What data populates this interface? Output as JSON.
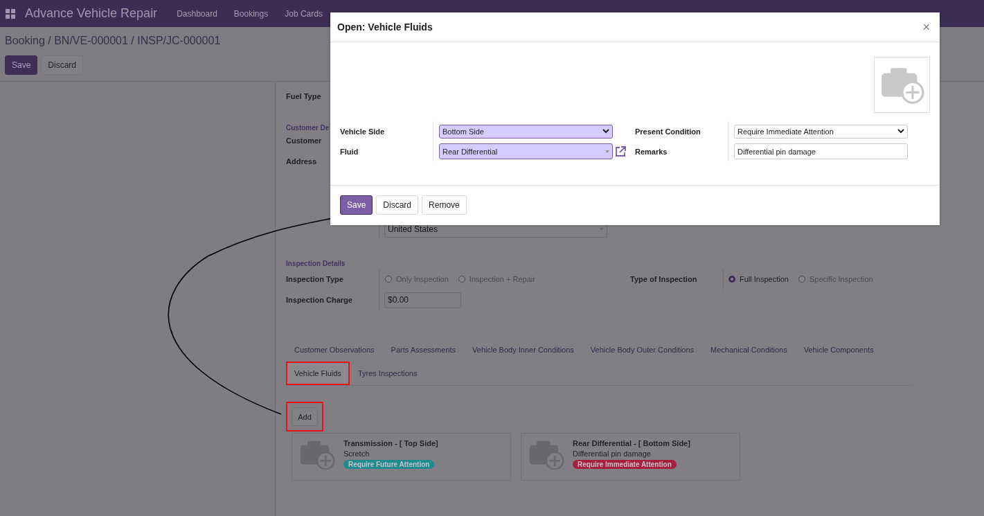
{
  "app": {
    "title": "Advance Vehicle Repair",
    "menu": [
      "Dashboard",
      "Bookings",
      "Job Cards"
    ]
  },
  "breadcrumb": "Booking / BN/VE-000001 / INSP/JC-000001",
  "form_buttons": [
    {
      "label": "Save",
      "kind": "primary"
    },
    {
      "label": "Discard",
      "kind": "secondary"
    }
  ],
  "form": {
    "fuel_type_label": "Fuel Type",
    "customer_section": "Customer De",
    "customer_label": "Customer",
    "address_label": "Address",
    "country": "United States",
    "inspection_section": "Inspection Details",
    "inspection_type": {
      "label": "Inspection Type",
      "options": [
        {
          "label": "Only Inspection",
          "selected": false
        },
        {
          "label": "Inspection + Repair",
          "selected": false
        }
      ]
    },
    "type_of_inspection": {
      "label": "Type of Inspection",
      "options": [
        {
          "label": "Full Inspection",
          "selected": true
        },
        {
          "label": "Specific Inspection",
          "selected": false
        }
      ]
    },
    "inspection_charge": {
      "label": "Inspection Charge",
      "value": "$0.00"
    }
  },
  "tabs": [
    {
      "label": "Customer Observations",
      "selected": false,
      "highlighted": false
    },
    {
      "label": "Parts Assessments",
      "selected": false,
      "highlighted": false
    },
    {
      "label": "Vehicle Body Inner Conditions",
      "selected": false,
      "highlighted": false
    },
    {
      "label": "Vehicle Body Outer Conditions",
      "selected": false,
      "highlighted": false
    },
    {
      "label": "Mechanical Conditions",
      "selected": false,
      "highlighted": false
    },
    {
      "label": "Vehicle Components",
      "selected": false,
      "highlighted": false
    },
    {
      "label": "Vehicle Fluids",
      "selected": true,
      "highlighted": true
    },
    {
      "label": "Tyres Inspections",
      "selected": false,
      "highlighted": false
    }
  ],
  "add_button": {
    "label": "Add",
    "highlighted": true
  },
  "cards": [
    {
      "title": "Transmission - [ Top Side]",
      "remarks": "Scretch",
      "condition": "Require Future Attention",
      "color": "#1e8b8f"
    },
    {
      "title": "Rear Differential - [ Bottom Side]",
      "remarks": "Differential pin damage",
      "condition": "Require Immediate Attention",
      "color": "#a81e3e"
    }
  ],
  "dialog": {
    "title": "Open: Vehicle Fluids",
    "close": "×",
    "fields": [
      {
        "label": "Vehicle Side",
        "value": "Bottom Side",
        "kind": "select",
        "required": true
      },
      {
        "label": "Present Condition",
        "value": "Require Immediate Attention",
        "kind": "select",
        "required": false
      },
      {
        "label": "Fluid",
        "value": "Rear Differential",
        "kind": "many2one",
        "required": true
      },
      {
        "label": "Remarks",
        "value": "Differential pin damage",
        "kind": "text",
        "required": false
      }
    ],
    "buttons": [
      {
        "label": "Save",
        "kind": "primary"
      },
      {
        "label": "Discard",
        "kind": "secondary"
      },
      {
        "label": "Remove",
        "kind": "secondary"
      }
    ]
  }
}
